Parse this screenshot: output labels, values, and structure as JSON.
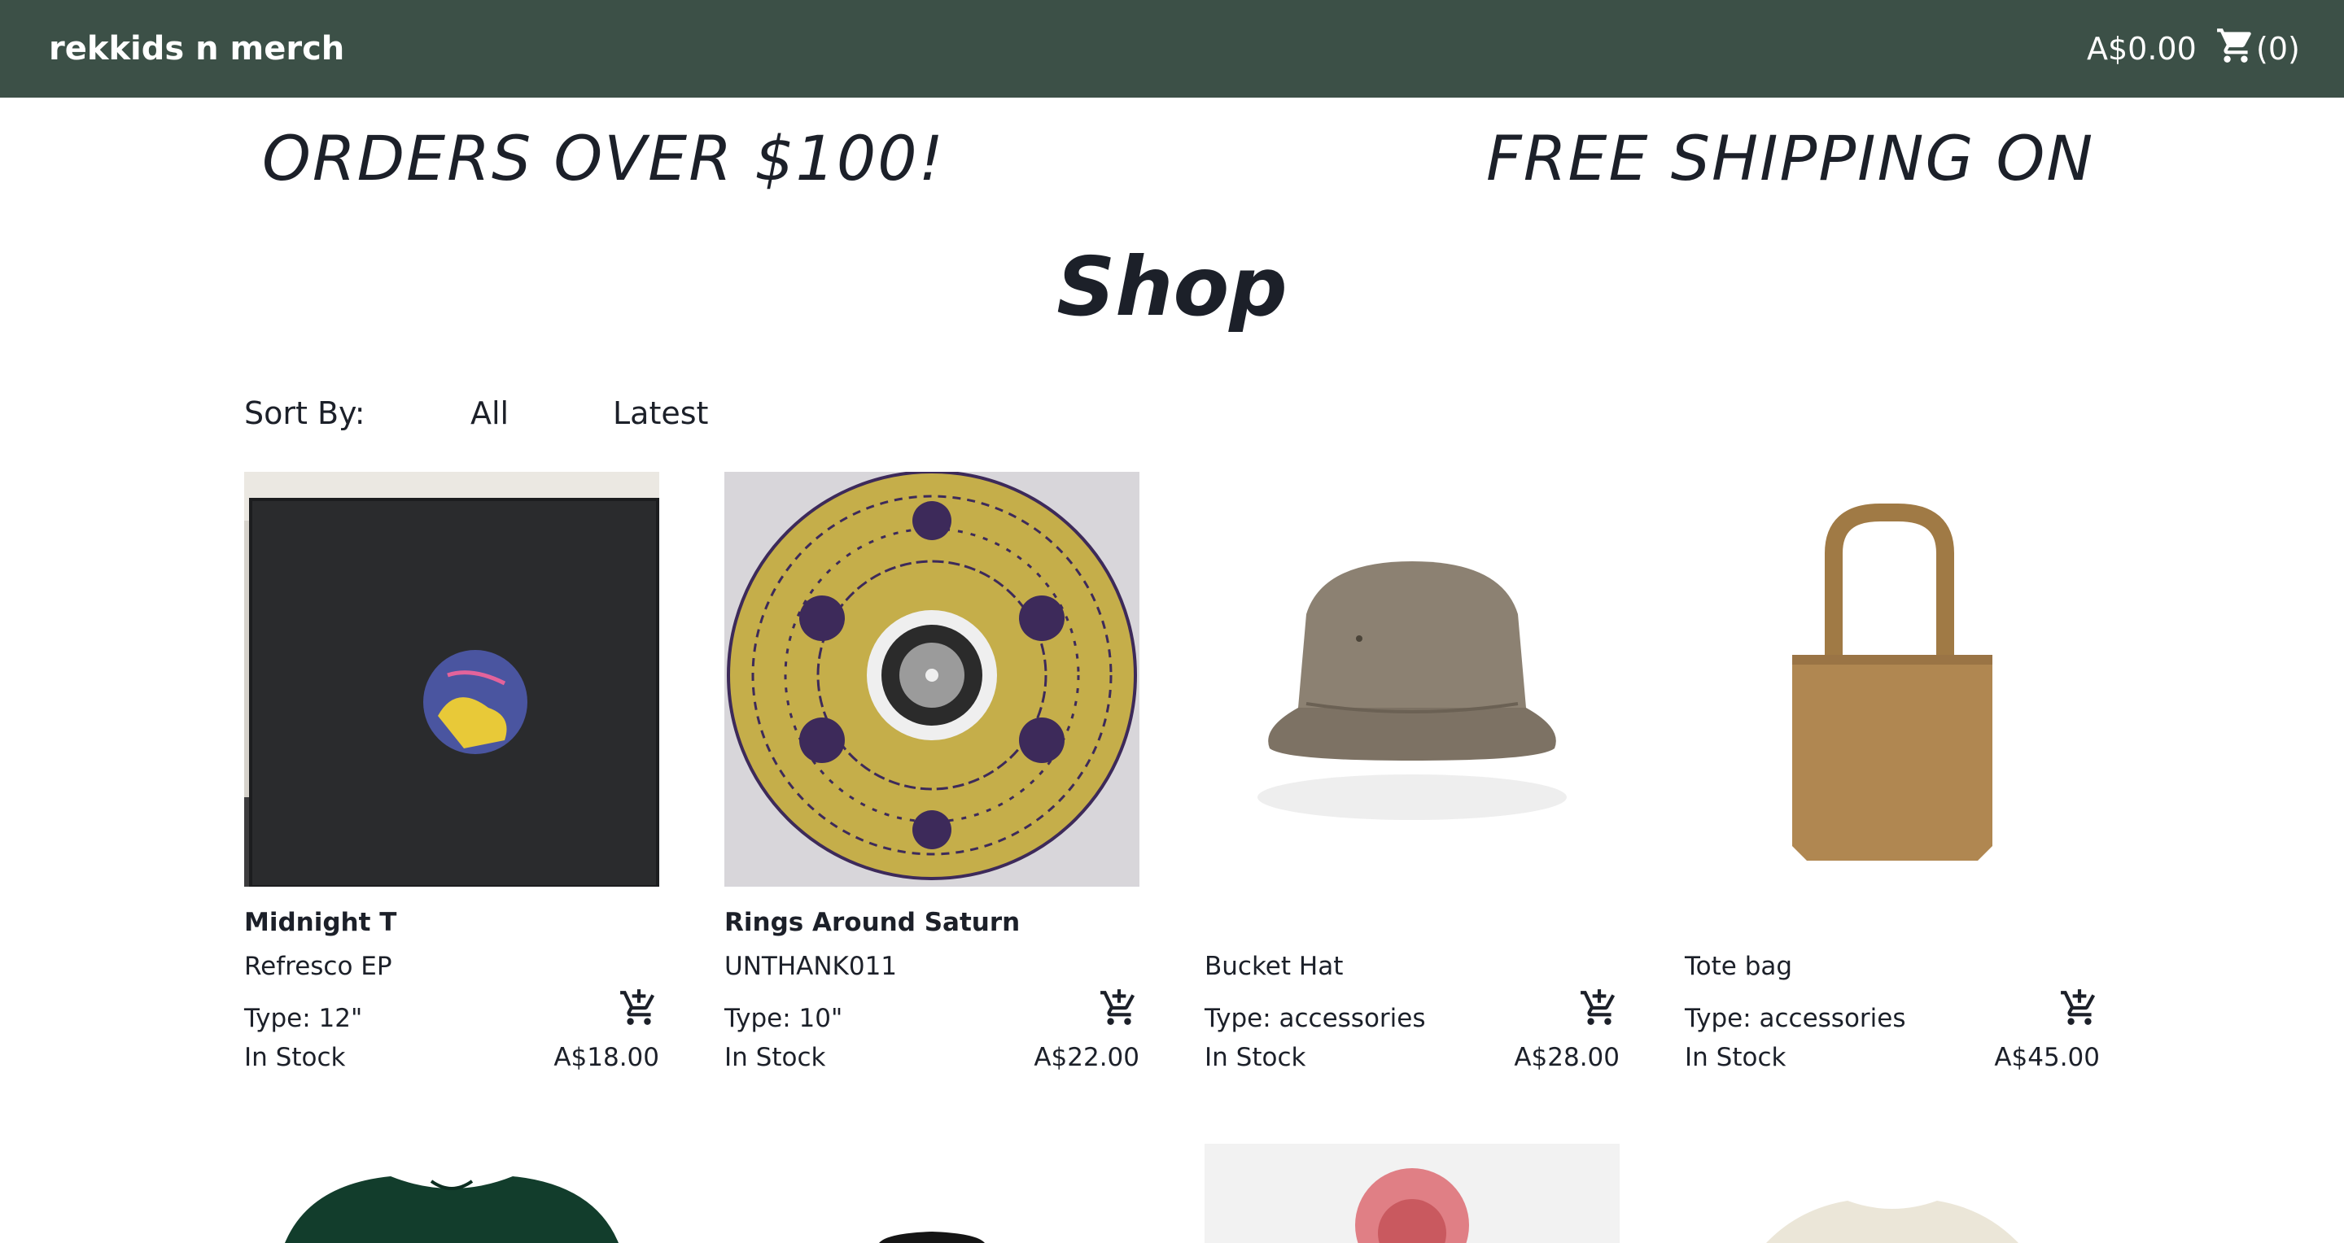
{
  "navbar": {
    "brand": "rekkids n merch",
    "cart_total": "A$0.00",
    "cart_count": "(0)"
  },
  "marquee": {
    "left_text": "ORDERS OVER $100!",
    "right_text": "FREE SHIPPING ON"
  },
  "page": {
    "title": "Shop"
  },
  "sort": {
    "label": "Sort By:",
    "options": [
      "All",
      "Latest"
    ]
  },
  "products": [
    {
      "title": "Midnight T",
      "subtitle": "Refresco EP",
      "type": "Type: 12\"",
      "stock": "In Stock",
      "price": "A$18.00"
    },
    {
      "title": "Rings Around Saturn",
      "subtitle": "UNTHANK011",
      "type": "Type: 10\"",
      "stock": "In Stock",
      "price": "A$22.00"
    },
    {
      "title": "",
      "subtitle": "Bucket Hat",
      "type": "Type: accessories",
      "stock": "In Stock",
      "price": "A$28.00"
    },
    {
      "title": "",
      "subtitle": "Tote bag",
      "type": "Type: accessories",
      "stock": "In Stock",
      "price": "A$45.00"
    }
  ],
  "icons": {
    "cart": "shopping-cart-icon",
    "add_to_cart": "add-shopping-cart-icon"
  },
  "colors": {
    "navbar_bg": "#3c5047",
    "text": "#1c2029"
  }
}
